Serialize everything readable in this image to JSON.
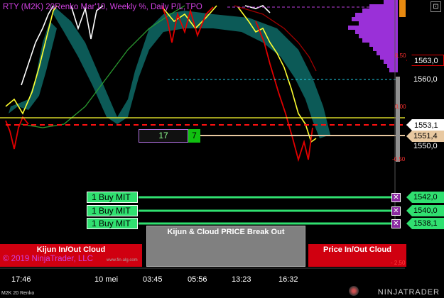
{
  "window": {
    "title": "RTY (M2K) 20Renko  Mar'10,  Weekly %,  Daily P/L,TPO",
    "close_icon": "⊡"
  },
  "colors": {
    "cloud": "#0e6a66",
    "ma_yellow": "#ffff30",
    "line_red": "#e00000",
    "line_white": "#ffffff",
    "ma_green": "#2a9a30",
    "tpo": "#9a30d8",
    "buy_green": "#30e070",
    "panel_red": "#d00010"
  },
  "price_axis": {
    "labels": [
      {
        "value": "1563,0",
        "style": "boxed-red"
      },
      {
        "value": "1560,0",
        "style": "outline"
      },
      {
        "value": "1553,1",
        "style": "boxed-white"
      },
      {
        "value": "1551,4",
        "style": "tan"
      },
      {
        "value": "1550,0",
        "style": "outline"
      }
    ],
    "pct_labels": [
      "0,50",
      "0,00",
      "-0,50",
      "- 2,50"
    ]
  },
  "order": {
    "value": "17",
    "qty": "7"
  },
  "buy_orders": [
    {
      "label": "1 Buy MIT",
      "price": "1542,0",
      "x_icon": "✕"
    },
    {
      "label": "1 Buy MIT",
      "price": "1540,0",
      "x_icon": "✕"
    },
    {
      "label": "1 Buy MIT",
      "price": "1538,1",
      "x_icon": "✕"
    }
  ],
  "panels": {
    "left": "Kijun In/Out Cloud",
    "middle": "Kijun & Cloud PRICE Break Out",
    "right": "Price In/Out Cloud"
  },
  "copyright": "© 2019 NinjaTrader, LLC",
  "watermark": "www.fin-alg.com",
  "x_axis": {
    "ticks": [
      "17:46",
      "10 mei",
      "03:45",
      "05:56",
      "13:23",
      "16:32"
    ]
  },
  "footer": {
    "series": "M2K 20 Renko",
    "brand": "NINJATRADER"
  }
}
